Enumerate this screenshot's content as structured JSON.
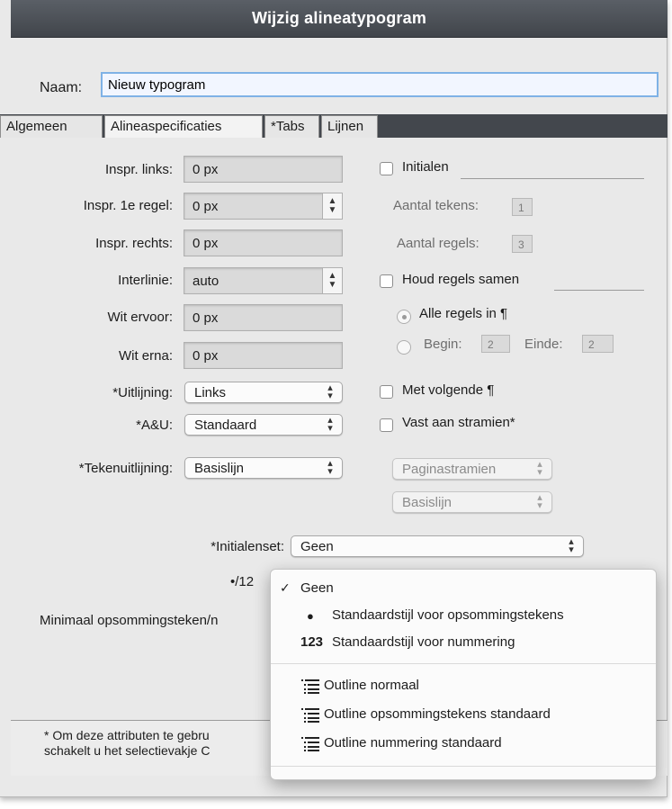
{
  "window": {
    "title": "Wijzig alineatypogram",
    "name_label": "Naam:",
    "name_value": "Nieuw typogram"
  },
  "tabs": [
    {
      "label": "Algemeen",
      "active": false
    },
    {
      "label": "Alineaspecificaties",
      "active": true
    },
    {
      "label": "*Tabs",
      "active": false
    },
    {
      "label": "Lijnen",
      "active": false
    }
  ],
  "left_fields": {
    "indent_left": {
      "label": "Inspr. links:",
      "value": "0 px"
    },
    "indent_first": {
      "label": "Inspr. 1e regel:",
      "value": "0 px"
    },
    "indent_right": {
      "label": "Inspr. rechts:",
      "value": "0 px"
    },
    "leading": {
      "label": "Interlinie:",
      "value": "auto"
    },
    "space_before": {
      "label": "Wit ervoor:",
      "value": "0 px"
    },
    "space_after": {
      "label": "Wit erna:",
      "value": "0 px"
    },
    "alignment": {
      "label": "*Uitlijning:",
      "value": "Links"
    },
    "hj": {
      "label": "*A&U:",
      "value": "Standaard"
    },
    "char_align": {
      "label": "*Tekenuitlijning:",
      "value": "Basislijn"
    }
  },
  "right_fields": {
    "initials": {
      "label": "Initialen",
      "checked": false
    },
    "char_count": {
      "label": "Aantal tekens:",
      "value": "1"
    },
    "line_count": {
      "label": "Aantal regels:",
      "value": "3"
    },
    "keep_together": {
      "label": "Houd regels samen",
      "checked": false
    },
    "all_lines": {
      "label": "Alle regels in ¶",
      "selected": true
    },
    "begin": {
      "label": "Begin:",
      "value": "2"
    },
    "end": {
      "label": "Einde:",
      "value": "2"
    },
    "keep_with_next": {
      "label": "Met volgende ¶",
      "checked": false
    },
    "lock_to_grid": {
      "label": "Vast aan stramien*",
      "checked": false
    },
    "grid_select": "Paginastramien",
    "baseline_select": "Basislijn"
  },
  "initials_set": {
    "label": "*Initialenset:",
    "value": "Geen"
  },
  "partial_labels": {
    "bullet_row": "•/12",
    "min_label": "Minimaal opsommingsteken/n"
  },
  "footer": {
    "line1": "* Om deze attributen te gebru",
    "line2": "schakelt u het selectievakje C"
  },
  "menu": {
    "items": [
      {
        "label": "Geen",
        "mark": "✓",
        "prefix": ""
      },
      {
        "label": "Standaardstijl voor opsommingstekens",
        "mark": "",
        "prefix": "●"
      },
      {
        "label": "Standaardstijl voor nummering",
        "mark": "",
        "prefix": "123"
      },
      {
        "label": "Outline normaal",
        "icon": "outline-list-icon"
      },
      {
        "label": "Outline opsommingstekens standaard",
        "icon": "outline-list-icon"
      },
      {
        "label": "Outline nummering standaard",
        "icon": "outline-list-icon"
      }
    ]
  }
}
